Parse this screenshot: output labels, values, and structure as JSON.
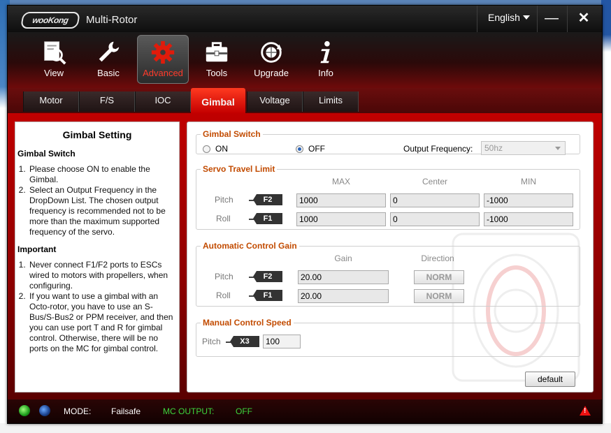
{
  "window": {
    "logo": "wooKong",
    "title": "Multi-Rotor",
    "language": "English"
  },
  "toolbar": {
    "items": [
      {
        "label": "View",
        "icon": "magnifier-icon"
      },
      {
        "label": "Basic",
        "icon": "wrench-icon"
      },
      {
        "label": "Advanced",
        "icon": "gear-icon",
        "active": true
      },
      {
        "label": "Tools",
        "icon": "toolbox-icon"
      },
      {
        "label": "Upgrade",
        "icon": "globe-refresh-icon"
      },
      {
        "label": "Info",
        "icon": "info-icon"
      }
    ]
  },
  "tabs": [
    "Motor",
    "F/S",
    "IOC",
    "Gimbal",
    "Voltage",
    "Limits"
  ],
  "active_tab": "Gimbal",
  "help": {
    "title": "Gimbal Setting",
    "section1": "Gimbal Switch",
    "items1": [
      "Please choose ON to enable the Gimbal.",
      "Select an Output Frequency in the DropDown List. The chosen output frequency is recommended not to be more than the maximum supported frequency of the servo."
    ],
    "section2": "Important",
    "items2": [
      "Never connect F1/F2 ports to ESCs wired to motors with propellers, when configuring.",
      "If you want to use a gimbal with an Octo-rotor, you have to use an S-Bus/S-Bus2 or PPM receiver, and then you can use port T and R for gimbal control. Otherwise, there will be no ports on the MC for gimbal control."
    ]
  },
  "gimbal_switch": {
    "legend": "Gimbal Switch",
    "on_label": "ON",
    "off_label": "OFF",
    "selected": "OFF",
    "freq_label": "Output Frequency:",
    "freq_value": "50hz"
  },
  "servo": {
    "legend": "Servo Travel Limit",
    "headers": {
      "max": "MAX",
      "center": "Center",
      "min": "MIN"
    },
    "rows": [
      {
        "label": "Pitch",
        "port": "F2",
        "max": "1000",
        "center": "0",
        "min": "-1000"
      },
      {
        "label": "Roll",
        "port": "F1",
        "max": "1000",
        "center": "0",
        "min": "-1000"
      }
    ]
  },
  "gain": {
    "legend": "Automatic Control Gain",
    "headers": {
      "gain": "Gain",
      "direction": "Direction"
    },
    "rows": [
      {
        "label": "Pitch",
        "port": "F2",
        "gain": "20.00",
        "direction": "NORM"
      },
      {
        "label": "Roll",
        "port": "F1",
        "gain": "20.00",
        "direction": "NORM"
      }
    ]
  },
  "speed": {
    "legend": "Manual Control Speed",
    "label": "Pitch",
    "port": "X3",
    "value": "100"
  },
  "default_button": "default",
  "status": {
    "mode_label": "MODE:",
    "mode_value": "Failsafe",
    "output_label": "MC OUTPUT:",
    "output_value": "OFF"
  },
  "colors": {
    "accent_red": "#c00000",
    "legend_orange": "#c24b00",
    "status_green": "#3dd63d",
    "active_label": "#ff3b2b"
  }
}
